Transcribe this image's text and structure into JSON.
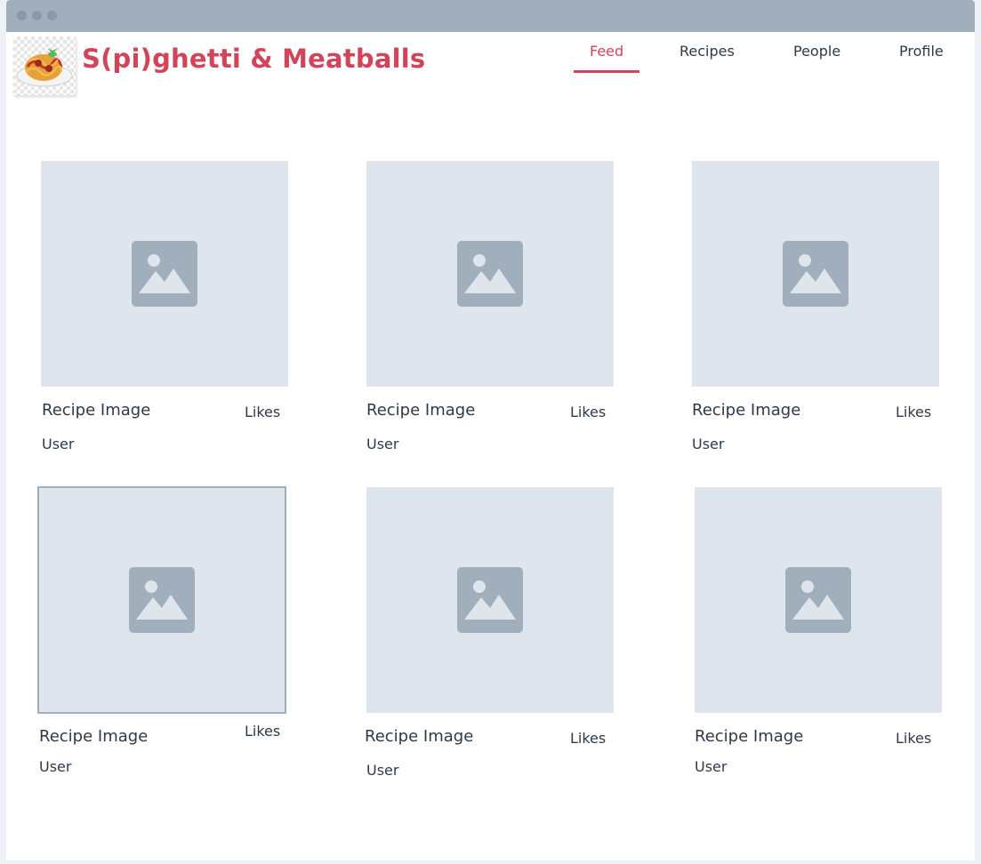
{
  "app": {
    "title": "S(pi)ghetti & Meatballs",
    "brand_color": "#d1455a",
    "logo_icon": "spaghetti-plate-icon"
  },
  "nav": {
    "items": [
      {
        "label": "Feed",
        "active": true
      },
      {
        "label": "Recipes",
        "active": false
      },
      {
        "label": "People",
        "active": false
      },
      {
        "label": "Profile",
        "active": false
      }
    ]
  },
  "feed": {
    "cards": [
      {
        "image_label": "Recipe Image",
        "likes_label": "Likes",
        "user_label": "User",
        "icon": "image-placeholder-icon",
        "selected": false
      },
      {
        "image_label": "Recipe Image",
        "likes_label": "Likes",
        "user_label": "User",
        "icon": "image-placeholder-icon",
        "selected": false
      },
      {
        "image_label": "Recipe Image",
        "likes_label": "Likes",
        "user_label": "User",
        "icon": "image-placeholder-icon",
        "selected": false
      },
      {
        "image_label": "Recipe Image",
        "likes_label": "Likes",
        "user_label": "User",
        "icon": "image-placeholder-icon",
        "selected": true
      },
      {
        "image_label": "Recipe Image",
        "likes_label": "Likes",
        "user_label": "User",
        "icon": "image-placeholder-icon",
        "selected": false
      },
      {
        "image_label": "Recipe Image",
        "likes_label": "Likes",
        "user_label": "User",
        "icon": "image-placeholder-icon",
        "selected": false
      }
    ]
  }
}
